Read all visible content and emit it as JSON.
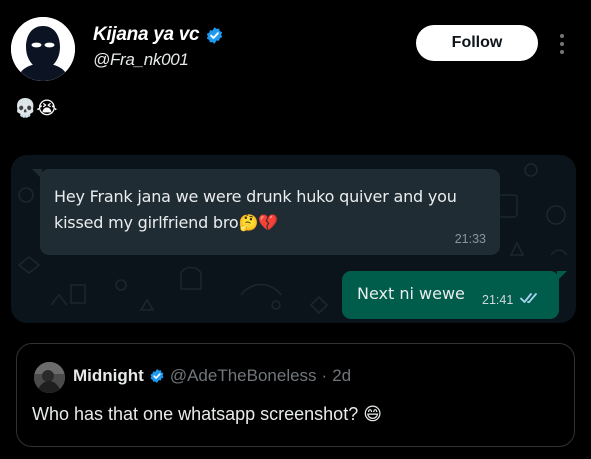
{
  "post": {
    "author": {
      "display_name": "Kijana ya vc",
      "handle": "@Fra_nk001",
      "verified": true,
      "avatar_icon": "balaclava-avatar-icon"
    },
    "follow_label": "Follow",
    "more_icon": "more-vertical-icon",
    "text": "💀😭"
  },
  "media": {
    "incoming_message": {
      "text": "Hey Frank jana we were drunk huko quiver and you kissed my girlfriend bro🤔💔",
      "time": "21:33"
    },
    "outgoing_message": {
      "text": "Next ni wewe",
      "time": "21:41",
      "status_icon": "double-check-icon"
    }
  },
  "quoted_post": {
    "author": {
      "display_name": "Midnight",
      "handle": "@AdeTheBoneless",
      "verified": true
    },
    "separator": "·",
    "time": "2d",
    "text": "Who has that one whatsapp screenshot? 😄"
  },
  "colors": {
    "background": "#000000",
    "verified_blue": "#1d9bf0",
    "chat_bg": "#0b141a",
    "bubble_in": "#202c33",
    "bubble_out": "#005c4b",
    "read_tick": "#a6d4ee",
    "muted_text": "#71767b"
  }
}
